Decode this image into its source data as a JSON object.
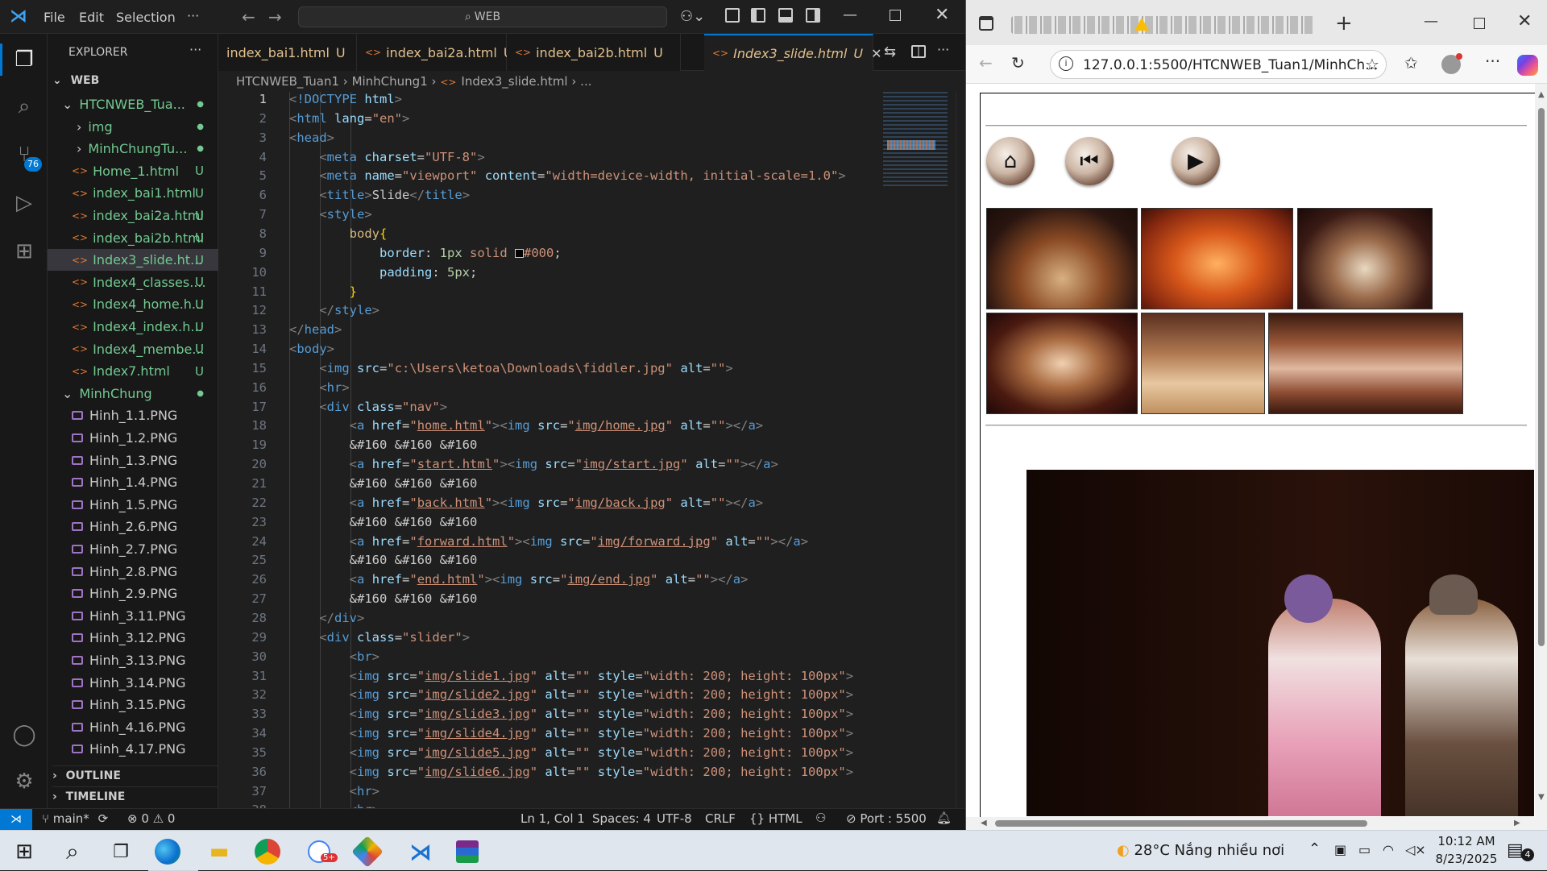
{
  "vscode": {
    "menu": [
      "File",
      "Edit",
      "Selection",
      "···"
    ],
    "search_label": "WEB",
    "tabs": [
      {
        "label": "index_bai1.html",
        "status": "U"
      },
      {
        "label": "index_bai2a.html",
        "status": "U"
      },
      {
        "label": "index_bai2b.html",
        "status": "U"
      },
      {
        "label": "Index3_slide.html",
        "status": "U"
      }
    ],
    "breadcrumb": [
      "HTCNWEB_Tuan1",
      "MinhChung1",
      "Index3_slide.html",
      "..."
    ],
    "explorer_title": "EXPLORER",
    "section_web": "WEB",
    "tree": [
      {
        "label": "HTCNWEB_Tua...",
        "status": "●"
      },
      {
        "label": "img",
        "status": "●"
      },
      {
        "label": "MinhChungTu...",
        "status": "●"
      },
      {
        "label": "Home_1.html",
        "status": "U"
      },
      {
        "label": "index_bai1.html",
        "status": "U"
      },
      {
        "label": "index_bai2a.html",
        "status": "U"
      },
      {
        "label": "index_bai2b.html",
        "status": "U"
      },
      {
        "label": "Index3_slide.ht...",
        "status": "U"
      },
      {
        "label": "Index4_classes....",
        "status": "U"
      },
      {
        "label": "Index4_home.h...",
        "status": "U"
      },
      {
        "label": "Index4_index.h...",
        "status": "U"
      },
      {
        "label": "Index4_membe...",
        "status": "U"
      },
      {
        "label": "Index7.html",
        "status": "U"
      },
      {
        "label": "MinhChung",
        "status": "●"
      },
      {
        "label": "Hinh_1.1.PNG"
      },
      {
        "label": "Hinh_1.2.PNG"
      },
      {
        "label": "Hinh_1.3.PNG"
      },
      {
        "label": "Hinh_1.4.PNG"
      },
      {
        "label": "Hinh_1.5.PNG"
      },
      {
        "label": "Hinh_2.6.PNG"
      },
      {
        "label": "Hinh_2.7.PNG"
      },
      {
        "label": "Hinh_2.8.PNG"
      },
      {
        "label": "Hinh_2.9.PNG"
      },
      {
        "label": "Hinh_3.11.PNG"
      },
      {
        "label": "Hinh_3.12.PNG"
      },
      {
        "label": "Hinh_3.13.PNG"
      },
      {
        "label": "Hinh_3.14.PNG"
      },
      {
        "label": "Hinh_3.15.PNG"
      },
      {
        "label": "Hinh_4.16.PNG"
      },
      {
        "label": "Hinh_4.17.PNG"
      }
    ],
    "outline": "OUTLINE",
    "timeline": "TIMELINE",
    "source_control_badge": "76",
    "status": {
      "branch": "main*",
      "problems": "⊗ 0 ⚠ 0",
      "position": "Ln 1, Col 1",
      "spaces": "Spaces: 4",
      "encoding": "UTF-8",
      "eol": "CRLF",
      "language": "{} HTML",
      "port": "⊘ Port : 5500"
    }
  },
  "browser": {
    "address": "127.0.0.1:5500/HTCNWEB_Tuan1/MinhCh..."
  },
  "taskbar": {
    "weather": "28°C  Nắng nhiều nơi",
    "time": "10:12 AM",
    "date": "8/23/2025",
    "notif_badge": "4",
    "chrome_badge": "5+"
  }
}
